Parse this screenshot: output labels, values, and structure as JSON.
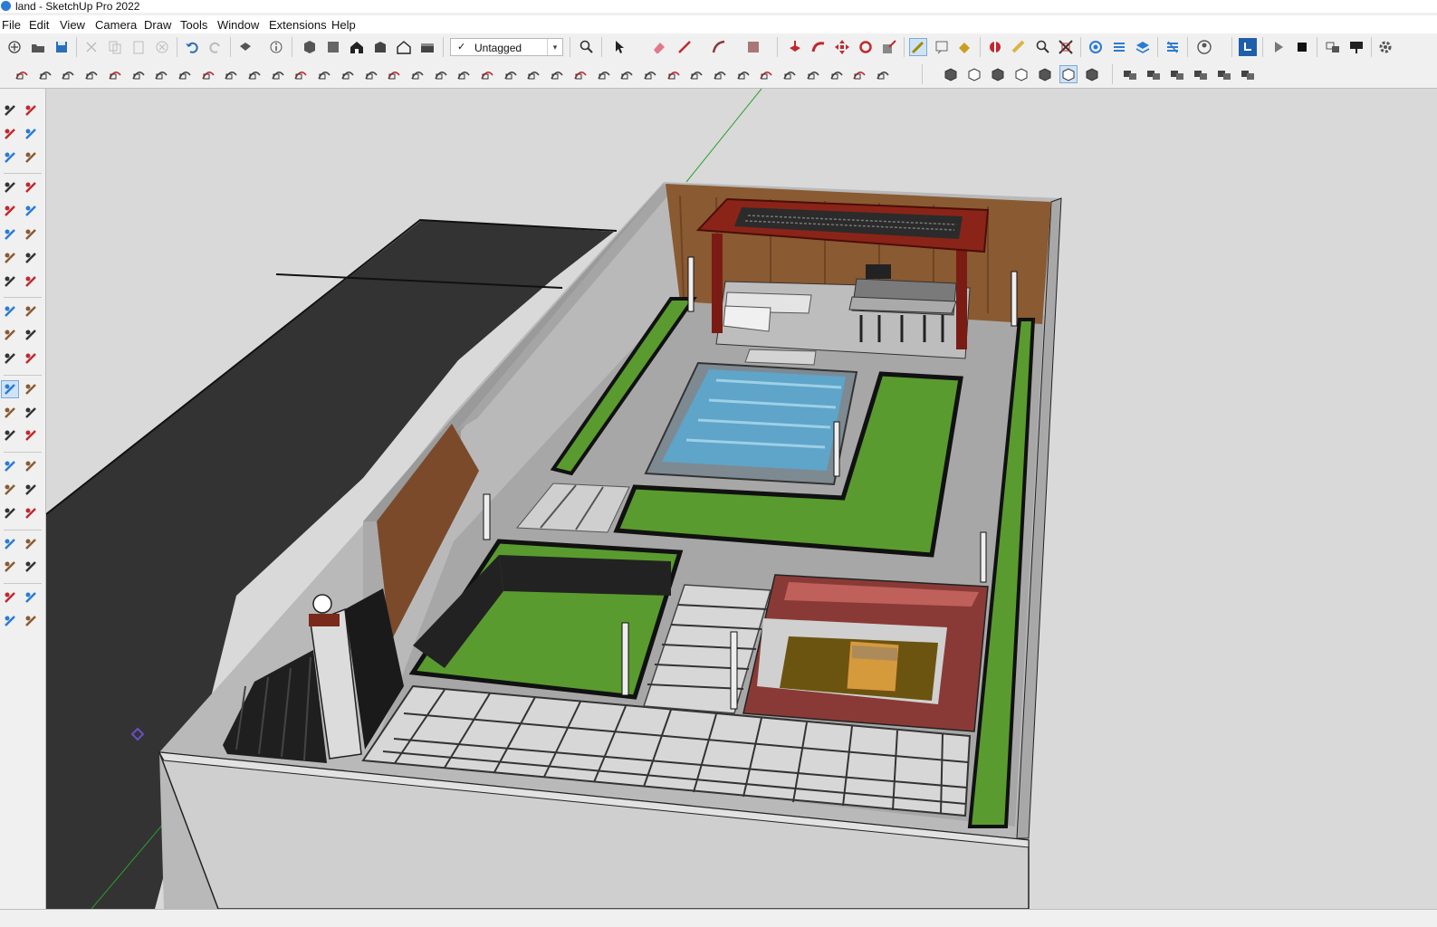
{
  "window": {
    "title": "land - SketchUp Pro 2022"
  },
  "menu": [
    "File",
    "Edit",
    "View",
    "Camera",
    "Draw",
    "Tools",
    "Window",
    "Extensions",
    "Help"
  ],
  "toolbar": {
    "tag_check": "✓",
    "tag_selected": "Untagged",
    "dropdown_arrow": "▾"
  },
  "icons": {
    "toolbar_row1": [
      "new-file-icon",
      "open-icon",
      "save-icon",
      "cut-icon",
      "copy-icon",
      "paste-icon",
      "erase-icon",
      "undo-icon",
      "redo-icon",
      "print-icon",
      "model-info-icon",
      "iso-view-icon",
      "top-view-icon",
      "front-view-icon",
      "right-view-icon",
      "back-view-icon",
      "left-view-icon",
      "zoom-icon",
      "select-icon",
      "eraser-icon",
      "line-icon",
      "arc-icon",
      "rectangle-icon",
      "pushpull-icon",
      "followme-icon",
      "move-icon",
      "rotate-icon",
      "scale-icon",
      "tape-measure-icon",
      "text-icon",
      "paint-bucket-icon",
      "section-plane-icon",
      "walk-icon",
      "zoom-window-icon",
      "zoom-extents-icon",
      "warehouse-icon",
      "extension-warehouse-icon",
      "layout-icon",
      "extension-manager-icon",
      "account-icon",
      "sketchup-icon",
      "play-icon",
      "stop-icon",
      "scene-icon",
      "camera-tool-icon",
      "settings-icon"
    ],
    "colors": {
      "accent": "#2a7bd4",
      "red_tool": "#c0282f",
      "grass": "#5a9b2f",
      "wood": "#8a5a32"
    }
  }
}
